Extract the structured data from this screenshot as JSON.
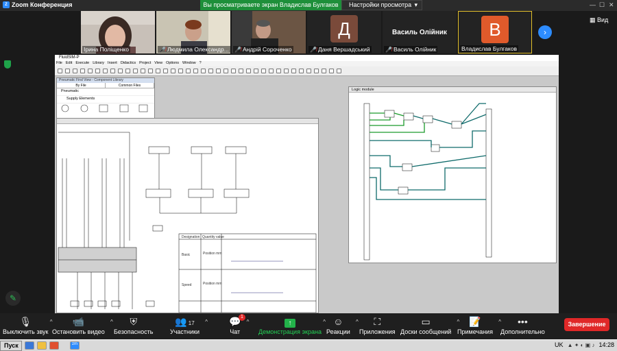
{
  "window": {
    "app_title": "Zoom Конференция",
    "share_banner": "Вы просматриваете экран Владислав Булгаков",
    "view_options": "Настройки просмотра",
    "view_label": "Вид"
  },
  "participants": [
    {
      "name": "Ірина Поліщенко",
      "muted": false
    },
    {
      "name": "Людмила Олександр...",
      "muted": true
    },
    {
      "name": "Андрій Сороченко",
      "muted": true
    },
    {
      "name": "Даня Вершадський",
      "muted": true,
      "initial": "Д",
      "color": "#7a4a3a"
    },
    {
      "name": "Василь Олійник",
      "muted": true
    },
    {
      "name": "Владислав Булгаков",
      "muted": false,
      "initial": "В",
      "color": "#e05a2b"
    }
  ],
  "shared_screen": {
    "app_title": "FluidSIM-P",
    "menu": [
      "File",
      "Edit",
      "Execute",
      "Library",
      "Insert",
      "Didactics",
      "Project",
      "View",
      "Options",
      "Window",
      "?"
    ],
    "library": {
      "title": "Pneumatic Find View - Component Library",
      "tabs": [
        "By File",
        "Common Files"
      ],
      "rows": [
        "Pneumatic",
        "Supply Elements"
      ]
    },
    "logic_title": "Logic module",
    "table_headers": [
      "Designation",
      "Quantity value"
    ],
    "table_rows": [
      "Basic",
      "Speed"
    ],
    "table_subrow": "Position mm"
  },
  "toolbar": {
    "mute": "Выключить звук",
    "video": "Остановить видео",
    "security": "Безопасность",
    "participants": "Участники",
    "participants_count": "17",
    "chat": "Чат",
    "chat_badge": "1",
    "share": "Демонстрация экрана",
    "reactions": "Реакции",
    "apps": "Приложения",
    "whiteboard": "Доски сообщений",
    "notes": "Примечания",
    "more": "Дополнительно",
    "end": "Завершение"
  },
  "taskbar": {
    "start": "Пуск",
    "lang": "UK",
    "time": "14:28"
  }
}
